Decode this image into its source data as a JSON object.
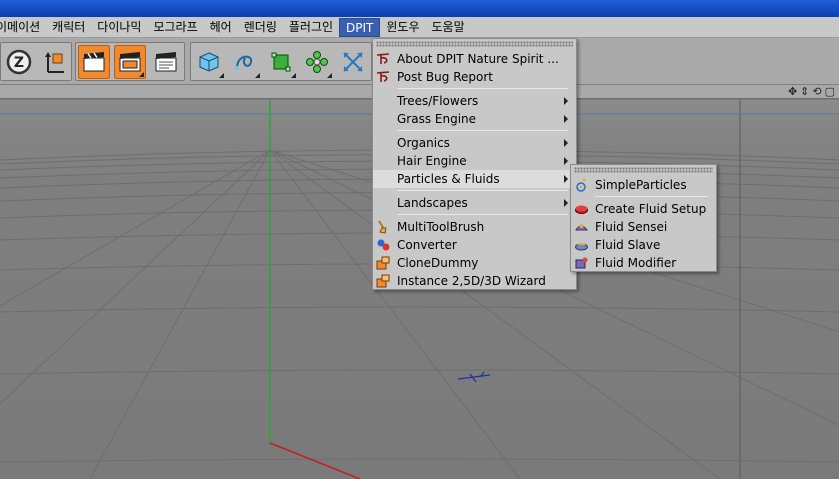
{
  "menubar": {
    "items": [
      "이메이션",
      "캐릭터",
      "다이나믹",
      "모그라프",
      "헤어",
      "렌더링",
      "플러그인",
      "DPIT",
      "윈도우",
      "도움말"
    ],
    "active_index": 7
  },
  "colors": {
    "menu_active": "#3a5fb0",
    "highlight": "#dcdcdc",
    "grid_axis_green": "#1fae2a",
    "grid_axis_red": "#c02020",
    "toolbar_orange": "#f08a30"
  },
  "toolbar": {
    "icons": [
      "snap-z-icon",
      "axis-icon",
      "render-view-icon",
      "render-picture-icon",
      "render-settings-icon",
      "cube-icon",
      "spline-pen-icon",
      "nurbs-cube-icon",
      "array-cloner-icon",
      "deformer-arrows-icon"
    ]
  },
  "dpit_menu": {
    "items": [
      {
        "label": "About DPIT Nature Spirit ...",
        "icon": "dpit-logo-icon"
      },
      {
        "label": "Post Bug Report",
        "icon": "dpit-logo-icon"
      },
      {
        "label": "Trees/Flowers",
        "submenu": true
      },
      {
        "label": "Grass Engine",
        "submenu": true
      },
      {
        "label": "Organics",
        "submenu": true
      },
      {
        "label": "Hair Engine",
        "submenu": true
      },
      {
        "label": "Particles & Fluids",
        "submenu": true,
        "highlighted": true
      },
      {
        "label": "Landscapes",
        "submenu": true
      },
      {
        "label": "MultiToolBrush",
        "icon": "brush-icon"
      },
      {
        "label": "Converter",
        "icon": "converter-icon"
      },
      {
        "label": "CloneDummy",
        "icon": "clone-icon"
      },
      {
        "label": "Instance 2,5D/3D Wizard",
        "icon": "instance-icon"
      }
    ]
  },
  "particles_submenu": {
    "items": [
      {
        "label": "SimpleParticles",
        "icon": "particles-icon"
      },
      {
        "label": "Create Fluid Setup",
        "icon": "fluid-setup-icon"
      },
      {
        "label": "Fluid Sensei",
        "icon": "fluid-sensei-icon"
      },
      {
        "label": "Fluid Slave",
        "icon": "fluid-slave-icon"
      },
      {
        "label": "Fluid Modifier",
        "icon": "fluid-modifier-icon"
      }
    ]
  }
}
